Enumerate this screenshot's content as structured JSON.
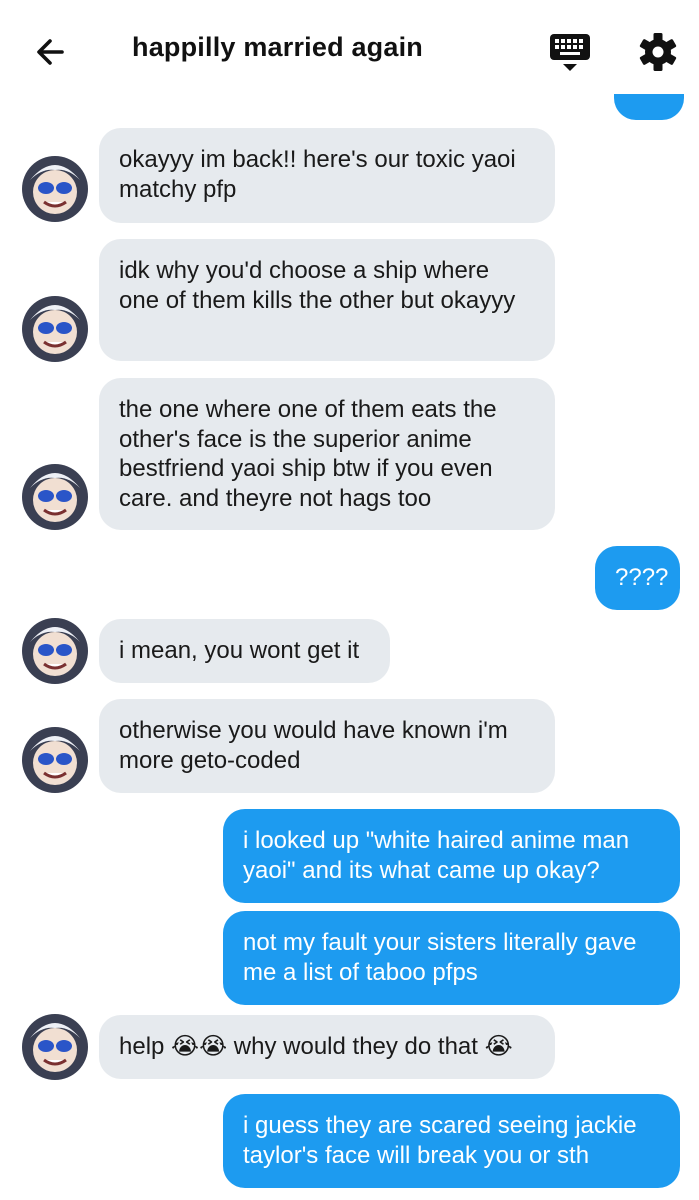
{
  "header": {
    "title": "happilly married again",
    "back_icon": "arrow-left-icon",
    "keyboard_icon": "keyboard-icon",
    "settings_icon": "gear-icon"
  },
  "colors": {
    "incoming_bubble": "#e6eaee",
    "outgoing_bubble": "#1d9bf0"
  },
  "messages": [
    {
      "dir": "out",
      "text": ""
    },
    {
      "dir": "in",
      "text": "okayyy im back!! here's our toxic yaoi matchy pfp"
    },
    {
      "dir": "in",
      "text": "idk why you'd choose a ship where one of them kills the other but okayyy"
    },
    {
      "dir": "in",
      "text": "the one where one of them eats the other's face is the superior anime bestfriend yaoi ship btw if you even care. and theyre not hags too"
    },
    {
      "dir": "out",
      "text": "????"
    },
    {
      "dir": "in",
      "text": "i mean, you wont get it"
    },
    {
      "dir": "in",
      "text": "otherwise you would have known i'm more geto-coded"
    },
    {
      "dir": "out",
      "text": "i looked up \"white haired anime man yaoi\" and its what came up  okay?"
    },
    {
      "dir": "out",
      "text": "not my fault your sisters literally gave me a list of taboo pfps"
    },
    {
      "dir": "in",
      "text": "help 😭😭 why would they do that 😭"
    },
    {
      "dir": "out",
      "text": "i guess they are scared seeing jackie taylor's face will break you or sth"
    }
  ]
}
